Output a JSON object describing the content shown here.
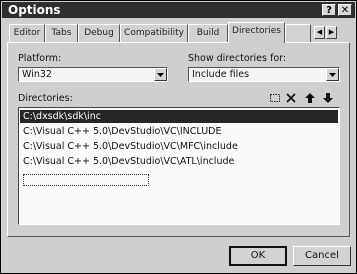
{
  "window": {
    "title": "Options",
    "help_button": "?",
    "close_button": "✕"
  },
  "tabs": [
    {
      "label": "Editor"
    },
    {
      "label": "Tabs"
    },
    {
      "label": "Debug"
    },
    {
      "label": "Compatibility"
    },
    {
      "label": "Build"
    },
    {
      "label": "Directories"
    }
  ],
  "tab_scroll": {
    "left": "◀",
    "right": "▶"
  },
  "platform": {
    "label": "Platform:",
    "value": "Win32"
  },
  "show_directories": {
    "label": "Show directories for:",
    "value": "Include files"
  },
  "directories": {
    "label": "Directories:",
    "items": [
      "C:\\dxsdk\\sdk\\inc",
      "C:\\Visual C++ 5.0\\DevStudio\\VC\\INCLUDE",
      "C:\\Visual C++ 5.0\\DevStudio\\VC\\MFC\\include",
      "C:\\Visual C++ 5.0\\DevStudio\\VC\\ATL\\include"
    ],
    "selected_index": 0
  },
  "buttons": {
    "ok": "OK",
    "cancel": "Cancel"
  },
  "colors": {
    "titlebar": "#2f2f2f",
    "selection": "#262626",
    "face": "#cfcfcf"
  }
}
